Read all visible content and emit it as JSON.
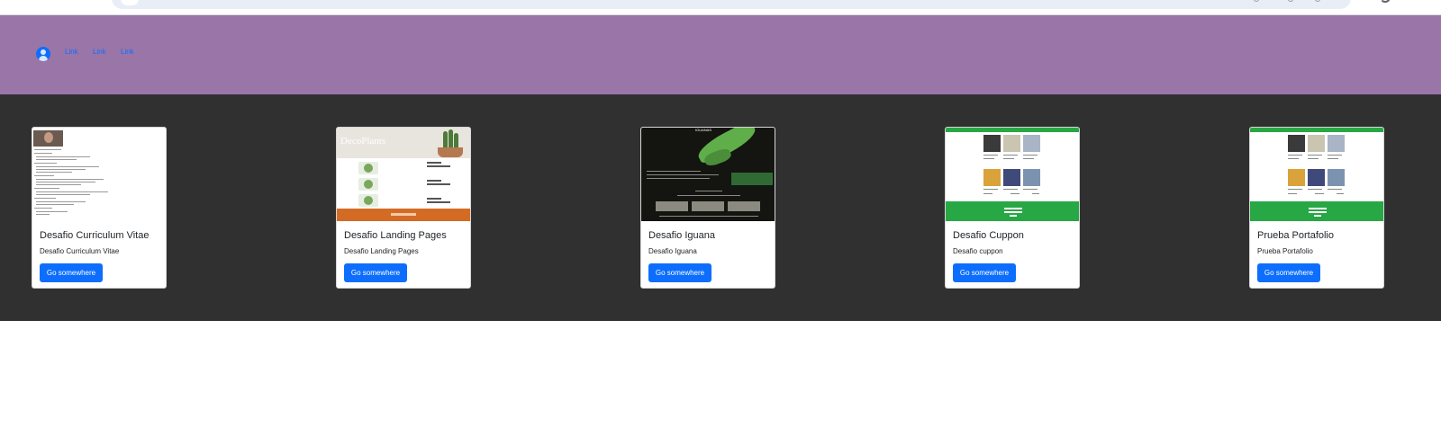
{
  "navbar": {
    "avatar_icon": "user-circle-icon",
    "links": [
      "Link",
      "Link",
      "Link"
    ],
    "background": "#9a75a8",
    "link_color": "#0d6efd"
  },
  "cards_section": {
    "background": "#303030"
  },
  "cards": [
    {
      "title": "Desafio Curriculum Vitae",
      "text": "Desafio Curriculum Vitae",
      "button": "Go somewhere"
    },
    {
      "title": "Desafio Landing Pages",
      "text": "Desafio Landing Pages",
      "button": "Go somewhere",
      "thumb_title": "DecoPlants"
    },
    {
      "title": "Desafio Iguana",
      "text": "Desafio Iguana",
      "button": "Go somewhere",
      "thumb_title": "IGUANAS"
    },
    {
      "title": "Desafio Cuppon",
      "text": "Desafio cuppon",
      "button": "Go somewhere"
    },
    {
      "title": "Prueba Portafolio",
      "text": "Prueba Portafolio",
      "button": "Go somewhere"
    }
  ],
  "colors": {
    "button": "#0d6efd",
    "cuppon_green": "#28a745",
    "landing_orange": "#d46b25"
  }
}
